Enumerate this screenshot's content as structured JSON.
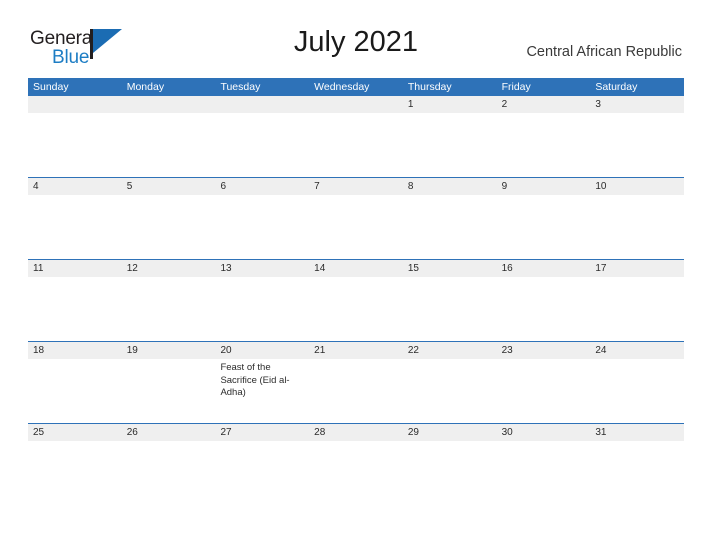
{
  "logo": {
    "word_top": "General",
    "word_bottom": "Blue",
    "mark": "triangle-flag",
    "color_dark": "#231f20",
    "color_blue": "#1d7dc4"
  },
  "header": {
    "title": "July 2021",
    "region": "Central African Republic"
  },
  "theme": {
    "header_blue": "#2e72b8",
    "band_gray": "#efefef",
    "text_dark": "#2b2b2b"
  },
  "calendar": {
    "weekdays": [
      "Sunday",
      "Monday",
      "Tuesday",
      "Wednesday",
      "Thursday",
      "Friday",
      "Saturday"
    ],
    "weeks": [
      [
        {
          "day": "",
          "events": []
        },
        {
          "day": "",
          "events": []
        },
        {
          "day": "",
          "events": []
        },
        {
          "day": "",
          "events": []
        },
        {
          "day": "1",
          "events": []
        },
        {
          "day": "2",
          "events": []
        },
        {
          "day": "3",
          "events": []
        }
      ],
      [
        {
          "day": "4",
          "events": []
        },
        {
          "day": "5",
          "events": []
        },
        {
          "day": "6",
          "events": []
        },
        {
          "day": "7",
          "events": []
        },
        {
          "day": "8",
          "events": []
        },
        {
          "day": "9",
          "events": []
        },
        {
          "day": "10",
          "events": []
        }
      ],
      [
        {
          "day": "11",
          "events": []
        },
        {
          "day": "12",
          "events": []
        },
        {
          "day": "13",
          "events": []
        },
        {
          "day": "14",
          "events": []
        },
        {
          "day": "15",
          "events": []
        },
        {
          "day": "16",
          "events": []
        },
        {
          "day": "17",
          "events": []
        }
      ],
      [
        {
          "day": "18",
          "events": []
        },
        {
          "day": "19",
          "events": []
        },
        {
          "day": "20",
          "events": [
            "Feast of the Sacrifice (Eid al-Adha)"
          ]
        },
        {
          "day": "21",
          "events": []
        },
        {
          "day": "22",
          "events": []
        },
        {
          "day": "23",
          "events": []
        },
        {
          "day": "24",
          "events": []
        }
      ],
      [
        {
          "day": "25",
          "events": []
        },
        {
          "day": "26",
          "events": []
        },
        {
          "day": "27",
          "events": []
        },
        {
          "day": "28",
          "events": []
        },
        {
          "day": "29",
          "events": []
        },
        {
          "day": "30",
          "events": []
        },
        {
          "day": "31",
          "events": []
        }
      ]
    ]
  }
}
